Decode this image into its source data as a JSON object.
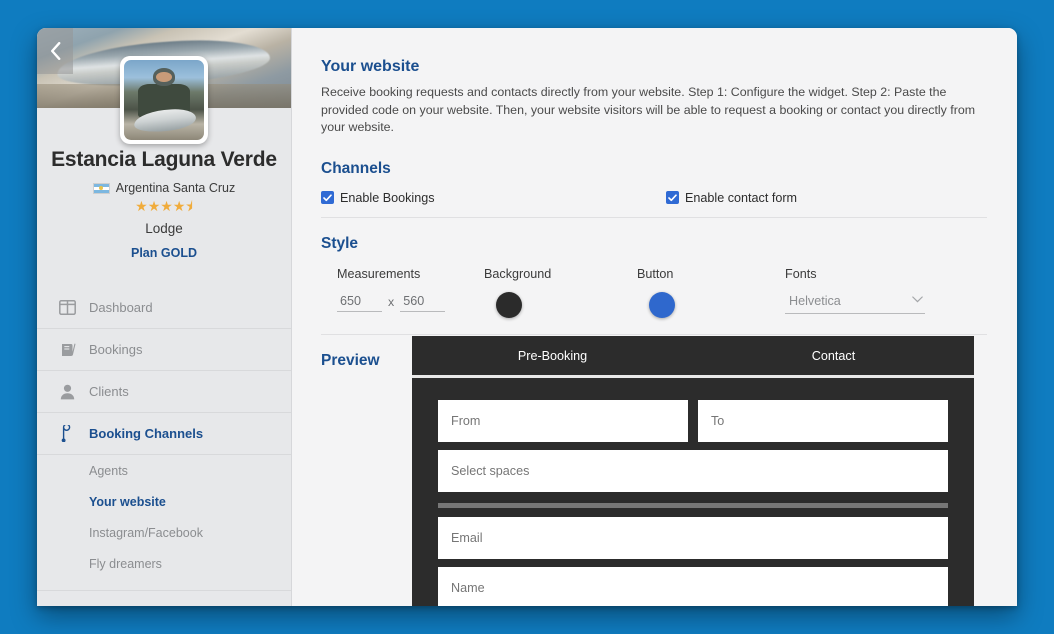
{
  "theme": {
    "backdrop_blue": "#0f7cc0",
    "accent_blue": "#1b4f8f",
    "checkbox_blue": "#2f6ad4",
    "sidebar_bg": "#e7e8ea",
    "main_bg": "#f4f4f5",
    "widget_dark": "#2c2c2c"
  },
  "sidebar": {
    "back_icon": "chevron-left-icon",
    "lodge_name": "Estancia Laguna Verde",
    "country_flag": "argentina-flag-icon",
    "location": "Argentina Santa Cruz",
    "rating": 4.5,
    "rating_stars_full": 4,
    "rating_stars_half": 1,
    "lodge_type": "Lodge",
    "plan": "Plan GOLD",
    "nav": [
      {
        "label": "Dashboard",
        "icon": "dashboard-icon",
        "active": false
      },
      {
        "label": "Bookings",
        "icon": "book-icon",
        "active": false
      },
      {
        "label": "Clients",
        "icon": "person-icon",
        "active": false
      },
      {
        "label": "Booking Channels",
        "icon": "channel-icon",
        "active": true
      }
    ],
    "subnav": [
      {
        "label": "Agents",
        "active": false
      },
      {
        "label": "Your website",
        "active": true
      },
      {
        "label": "Instagram/Facebook",
        "active": false
      },
      {
        "label": "Fly dreamers",
        "active": false
      }
    ]
  },
  "main": {
    "page_title": "Your website",
    "page_description": "Receive booking requests and contacts directly from your website. Step 1: Configure the widget. Step 2: Paste the provided code on your website. Then, your website visitors will be able to request a booking or contact you directly from your website.",
    "channels": {
      "title": "Channels",
      "options": [
        {
          "label": "Enable Bookings",
          "checked": true
        },
        {
          "label": "Enable contact form",
          "checked": true
        }
      ]
    },
    "style": {
      "title": "Style",
      "measurements_label": "Measurements",
      "width_value": "650",
      "width_placeholder": "650",
      "separator": "x",
      "height_value": "560",
      "height_placeholder": "560",
      "background_label": "Background",
      "background_color": "#2b2b2b",
      "button_label": "Button",
      "button_color": "#2f68cd",
      "fonts_label": "Fonts",
      "font_selected": "Helvetica",
      "font_chevron": "chevron-down-icon"
    },
    "preview": {
      "title": "Preview",
      "tabs": [
        {
          "label": "Pre-Booking",
          "active": true
        },
        {
          "label": "Contact",
          "active": false
        }
      ],
      "fields": [
        {
          "placeholder": "From",
          "size": "half"
        },
        {
          "placeholder": "To",
          "size": "half"
        },
        {
          "placeholder": "Select spaces",
          "size": "full"
        },
        {
          "placeholder": "Email",
          "size": "full"
        },
        {
          "placeholder": "Name",
          "size": "full"
        }
      ]
    }
  }
}
